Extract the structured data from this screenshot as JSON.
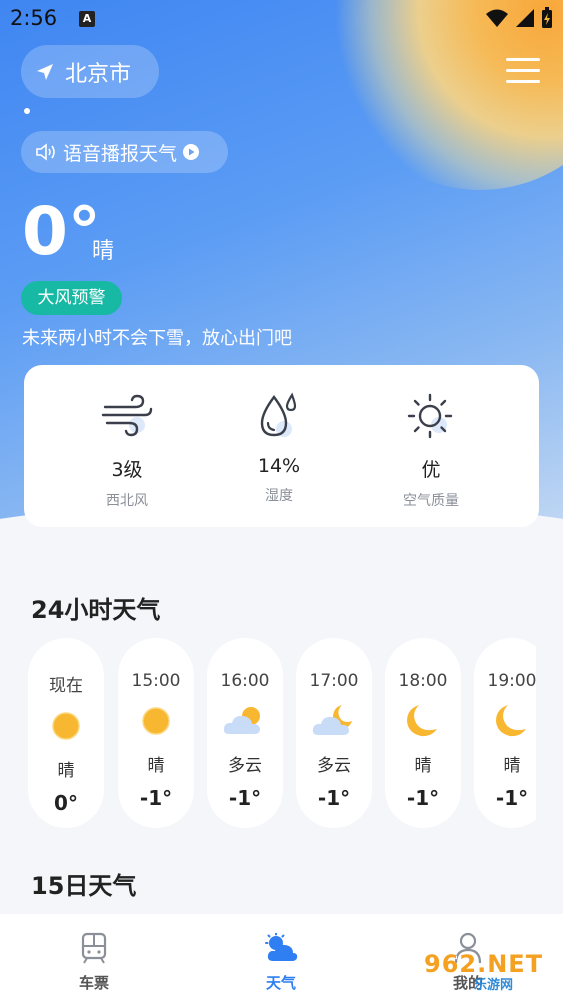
{
  "status_bar": {
    "time": "2:56",
    "app_badge": "A"
  },
  "header": {
    "city": "北京市",
    "voice_label": "语音播报天气"
  },
  "current": {
    "temperature": "0°",
    "condition": "晴",
    "alert": "大风预警",
    "forecast_message": "未来两小时不会下雪，放心出门吧"
  },
  "details": [
    {
      "value": "3级",
      "label": "西北风",
      "icon": "wind-icon"
    },
    {
      "value": "14%",
      "label": "湿度",
      "icon": "humidity-icon"
    },
    {
      "value": "优",
      "label": "空气质量",
      "icon": "sun-air-icon"
    }
  ],
  "hourly": {
    "title": "24小时天气",
    "items": [
      {
        "time": "现在",
        "condition": "晴",
        "temp": "0°",
        "icon": "sun-icon"
      },
      {
        "time": "15:00",
        "condition": "晴",
        "temp": "-1°",
        "icon": "sun-icon"
      },
      {
        "time": "16:00",
        "condition": "多云",
        "temp": "-1°",
        "icon": "cloud-sun-icon"
      },
      {
        "time": "17:00",
        "condition": "多云",
        "temp": "-1°",
        "icon": "cloud-moon-icon"
      },
      {
        "time": "18:00",
        "condition": "晴",
        "temp": "-1°",
        "icon": "moon-icon"
      },
      {
        "time": "19:00",
        "condition": "晴",
        "temp": "-1°",
        "icon": "moon-icon"
      }
    ]
  },
  "daily": {
    "title": "15日天气"
  },
  "tabs": [
    {
      "label": "车票",
      "icon": "train-icon",
      "active": false
    },
    {
      "label": "天气",
      "icon": "weather-icon",
      "active": true
    },
    {
      "label": "我的",
      "icon": "profile-icon",
      "active": false
    }
  ],
  "watermark": {
    "top": "962.NET",
    "bottom": "乐游网"
  },
  "colors": {
    "accent": "#2f7ff2",
    "alert": "#18b9a4",
    "sun": "#f7b731",
    "inactive_tab": "#8a8f98"
  }
}
